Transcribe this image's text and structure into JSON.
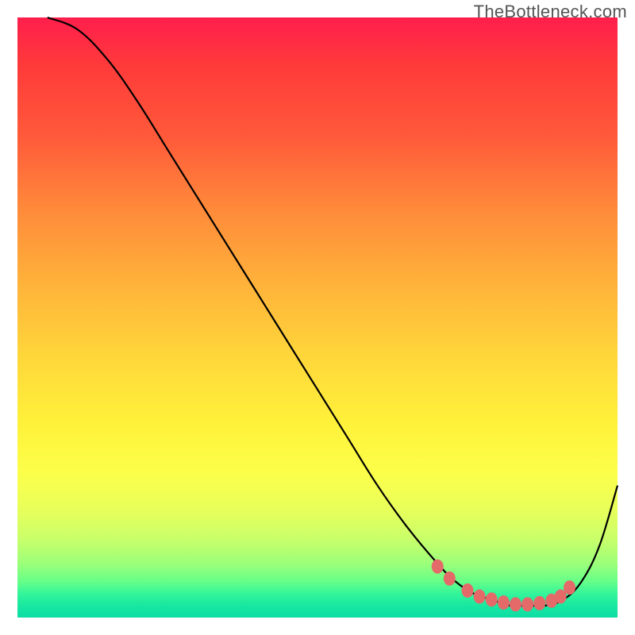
{
  "chart_data": {
    "type": "line",
    "title": "",
    "xlabel": "",
    "ylabel": "",
    "xlim": [
      0,
      100
    ],
    "ylim": [
      0,
      100
    ],
    "watermark": "TheBottleneck.com",
    "colors": {
      "top_gradient": "#ff1e4c",
      "bottom_gradient": "#0ddca5",
      "curve": "#000000",
      "marker": "#e46a6a"
    },
    "series": [
      {
        "name": "bottleneck-curve",
        "x": [
          5,
          10,
          15,
          20,
          25,
          30,
          35,
          40,
          45,
          50,
          55,
          60,
          65,
          70,
          73,
          76,
          79,
          82,
          85,
          88,
          91,
          94,
          97,
          100
        ],
        "y": [
          100,
          98,
          93,
          86,
          78,
          70,
          62,
          54,
          46,
          38,
          30,
          22,
          15,
          9,
          6,
          4,
          3,
          2,
          2,
          2,
          3,
          6,
          12,
          22
        ]
      }
    ],
    "markers": {
      "name": "highlight-dots",
      "x": [
        70,
        72,
        75,
        77,
        79,
        81,
        83,
        85,
        87,
        89,
        90.5,
        92
      ],
      "y": [
        8.5,
        6.5,
        4.5,
        3.5,
        3,
        2.5,
        2.2,
        2.2,
        2.4,
        2.8,
        3.5,
        5
      ]
    }
  }
}
